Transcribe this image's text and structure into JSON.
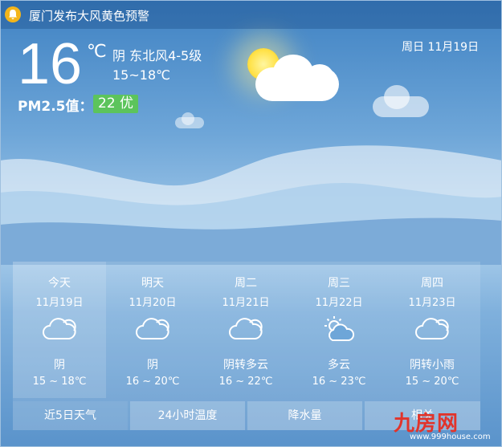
{
  "alert": {
    "icon": "bell-icon",
    "text": "厦门发布大风黄色预警"
  },
  "current": {
    "temperature": "16",
    "unit": "℃",
    "condition": "阴 东北风4-5级",
    "range": "15~18℃",
    "pm_label": "PM2.5值：",
    "pm_value": "22 优",
    "date": "周日  11月19日"
  },
  "forecast": [
    {
      "name": "今天",
      "date": "11月19日",
      "icon": "cloudy-icon",
      "weather": "阴",
      "range": "15 ~ 18℃"
    },
    {
      "name": "明天",
      "date": "11月20日",
      "icon": "cloudy-icon",
      "weather": "阴",
      "range": "16 ~ 20℃"
    },
    {
      "name": "周二",
      "date": "11月21日",
      "icon": "cloudy-icon",
      "weather": "阴转多云",
      "range": "16 ~ 22℃"
    },
    {
      "name": "周三",
      "date": "11月22日",
      "icon": "partly-cloudy-icon",
      "weather": "多云",
      "range": "16 ~ 23℃"
    },
    {
      "name": "周四",
      "date": "11月23日",
      "icon": "cloudy-icon",
      "weather": "阴转小雨",
      "range": "15 ~ 20℃"
    }
  ],
  "tabs": [
    "近5日天气",
    "24小时温度",
    "降水量",
    "相关"
  ],
  "watermark": {
    "text": "九房网",
    "url": "www.999house.com"
  },
  "colors": {
    "pm_good": "#5cc45c",
    "alert_icon": "#f3b51a",
    "watermark": "#e1342b"
  }
}
